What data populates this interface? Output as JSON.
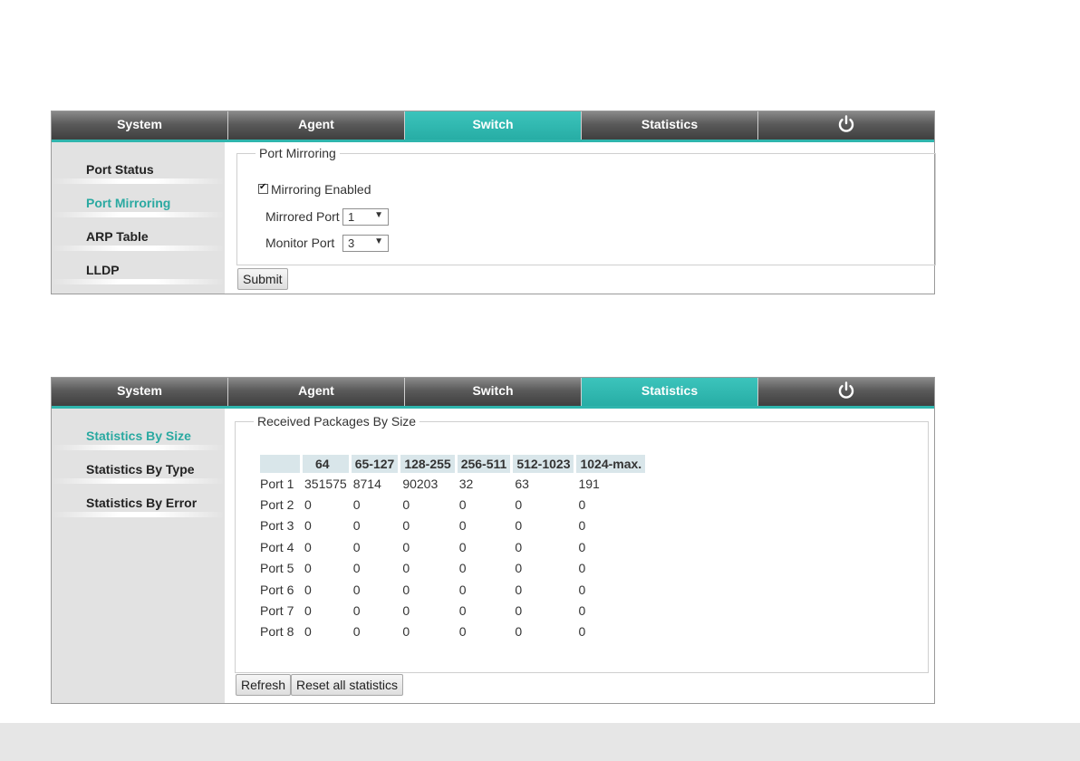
{
  "top_panel": {
    "tabs": [
      "System",
      "Agent",
      "Switch",
      "Statistics"
    ],
    "active_tab": "Switch",
    "sidebar": [
      "Port Status",
      "Port Mirroring",
      "ARP Table",
      "LLDP"
    ],
    "active_sidebar": "Port Mirroring",
    "group_title": "Port Mirroring",
    "mirroring_enabled_label": "Mirroring Enabled",
    "mirroring_enabled": true,
    "mirrored_port_label": "Mirrored Port",
    "mirrored_port_value": "1",
    "monitor_port_label": "Monitor Port",
    "monitor_port_value": "3",
    "submit_label": "Submit"
  },
  "bottom_panel": {
    "tabs": [
      "System",
      "Agent",
      "Switch",
      "Statistics"
    ],
    "active_tab": "Statistics",
    "sidebar": [
      "Statistics By Size",
      "Statistics By Type",
      "Statistics By Error"
    ],
    "active_sidebar": "Statistics By Size",
    "group_title": "Received Packages By Size",
    "columns": [
      "",
      "64",
      "65-127",
      "128-255",
      "256-511",
      "512-1023",
      "1024-max."
    ],
    "rows": [
      [
        "Port 1",
        "351575",
        "8714",
        "90203",
        "32",
        "63",
        "191"
      ],
      [
        "Port 2",
        "0",
        "0",
        "0",
        "0",
        "0",
        "0"
      ],
      [
        "Port 3",
        "0",
        "0",
        "0",
        "0",
        "0",
        "0"
      ],
      [
        "Port 4",
        "0",
        "0",
        "0",
        "0",
        "0",
        "0"
      ],
      [
        "Port 5",
        "0",
        "0",
        "0",
        "0",
        "0",
        "0"
      ],
      [
        "Port 6",
        "0",
        "0",
        "0",
        "0",
        "0",
        "0"
      ],
      [
        "Port 7",
        "0",
        "0",
        "0",
        "0",
        "0",
        "0"
      ],
      [
        "Port 8",
        "0",
        "0",
        "0",
        "0",
        "0",
        "0"
      ]
    ],
    "refresh_label": "Refresh",
    "reset_label": "Reset all statistics"
  },
  "icons": {
    "power": "power-icon",
    "dropdown": "dropdown-arrow-icon",
    "checkbox": "checkbox-checked-icon"
  },
  "colors": {
    "accent": "#2fb5ad",
    "tab_dark": "#4a4a4a",
    "sidebar_bg": "#e2e2e2",
    "table_header": "#d9e6ea"
  }
}
